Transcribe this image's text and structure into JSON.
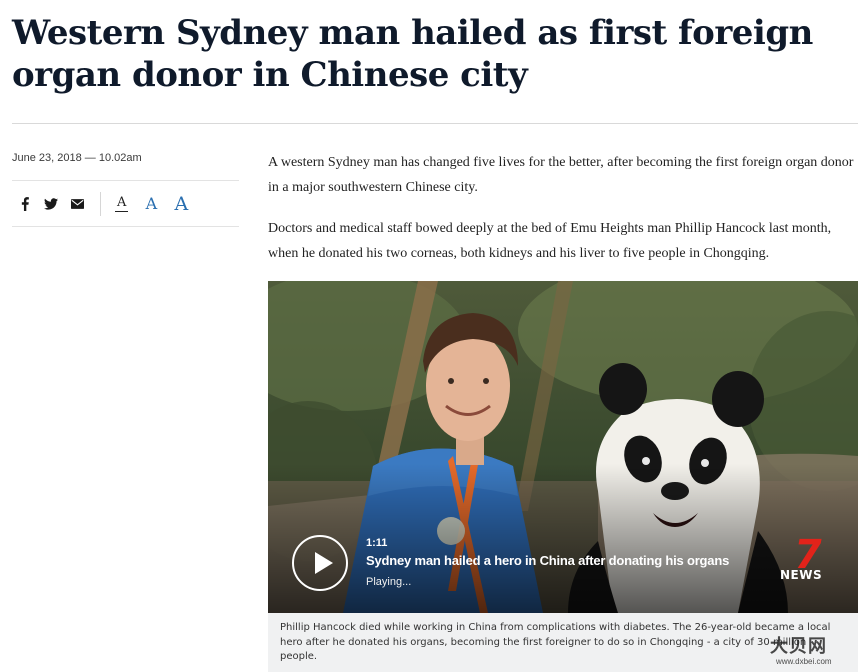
{
  "article": {
    "headline": "Western Sydney man hailed as first foreign organ donor in Chinese city",
    "dateline": "June 23, 2018 — 10.02am",
    "paragraphs": [
      "A western Sydney man has changed five lives for the better, after becoming the first foreign organ donor in a major southwestern Chinese city.",
      "Doctors and medical staff bowed deeply at the bed of Emu Heights man Phillip Hancock last month, when he donated his two corneas, both kidneys and his liver to five people in Chongqing."
    ]
  },
  "toolbar": {
    "share_icons": [
      "facebook-icon",
      "twitter-icon",
      "email-icon"
    ],
    "font_sizes": [
      "A",
      "A",
      "A"
    ]
  },
  "video": {
    "duration": "1:11",
    "title": "Sydney man hailed a hero in China after donating his organs",
    "status": "Playing...",
    "logo_number": "7",
    "logo_text": "NEWS",
    "caption": "Phillip Hancock died while working in China from complications with diabetes. The 26-year-old became a local hero after he donated his organs, becoming the first foreigner to do so in Chongqing - a city of 30 million people."
  },
  "watermark": {
    "text": "大贝网",
    "url": "www.dxbei.com"
  },
  "colors": {
    "headline": "#0f1a2b",
    "link_blue": "#2a6fb0",
    "news_red": "#e2231a",
    "caption_bg": "#f0f1f2"
  }
}
